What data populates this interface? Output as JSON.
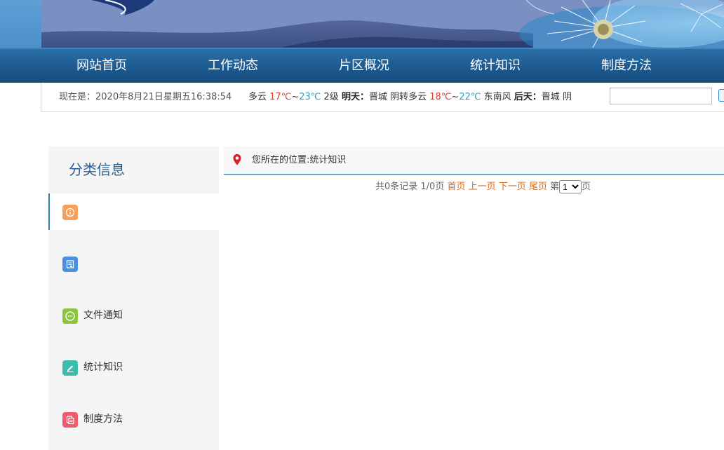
{
  "nav": {
    "items": [
      {
        "label": "网站首页"
      },
      {
        "label": "工作动态"
      },
      {
        "label": "片区概况"
      },
      {
        "label": "统计知识"
      },
      {
        "label": "制度方法"
      }
    ]
  },
  "infobar": {
    "datetime": "现在是：2020年8月21日星期五16:38:54",
    "weather": {
      "prefix": "转多云",
      "today_low": "17℃",
      "tilde1": "~",
      "today_high": "23℃",
      "wind_today": "2级",
      "tomorrow_label": "明天：",
      "tomorrow_city": "晋城",
      "tomorrow_cond": "阴转多云",
      "tomorrow_low": "18℃",
      "tilde2": "~",
      "tomorrow_high": "22℃",
      "tomorrow_wind": "东南风",
      "after_label": "后天：",
      "after_city": "晋城",
      "after_cond": "阴"
    },
    "search": {
      "value": "",
      "placeholder": ""
    }
  },
  "sidebar": {
    "title": "分类信息",
    "items": [
      {
        "label": "",
        "icon": "info-icon",
        "color": "#f6a05b"
      },
      {
        "label": "",
        "icon": "document-icon",
        "color": "#4a8fe0"
      },
      {
        "label": "文件通知",
        "icon": "chat-icon",
        "color": "#8cc63f"
      },
      {
        "label": "统计知识",
        "icon": "pencil-icon",
        "color": "#3dbbad"
      },
      {
        "label": "制度方法",
        "icon": "files-icon",
        "color": "#ef5a6e"
      }
    ]
  },
  "content": {
    "location": "您所在的位置:统计知识",
    "pager": {
      "summary": "共0条记录 1/0页",
      "first": "首页",
      "prev": "上一页",
      "next": "下一页",
      "last": "尾页",
      "page_prefix": "第",
      "page_value": "1",
      "page_suffix": "页"
    }
  },
  "colors": {
    "nav_bg": "#1d5a90",
    "accent": "#2d7fa8",
    "link": "#d2691e"
  }
}
